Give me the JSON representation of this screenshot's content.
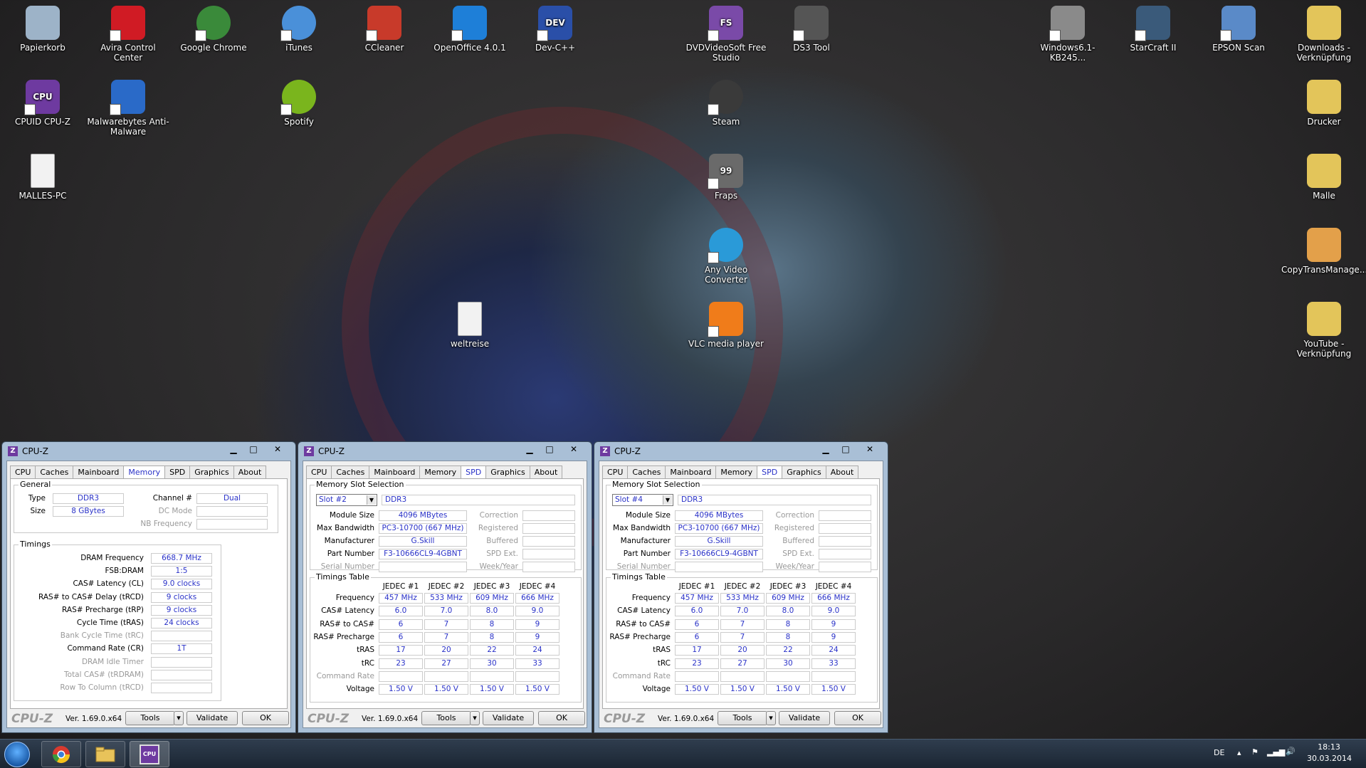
{
  "desktop_icons": [
    {
      "label": "Papierkorb",
      "icon": "recycle-bin-icon",
      "color": "#9db3c8"
    },
    {
      "label": "Avira Control Center",
      "icon": "avira-icon",
      "color": "#d01b24"
    },
    {
      "label": "Google Chrome",
      "icon": "chrome-icon",
      "color": "#3a8a3a"
    },
    {
      "label": "iTunes",
      "icon": "itunes-icon",
      "color": "#4a90d9"
    },
    {
      "label": "CCleaner",
      "icon": "ccleaner-icon",
      "color": "#c83a2a"
    },
    {
      "label": "OpenOffice 4.0.1",
      "icon": "openoffice-icon",
      "color": "#1e7fd8"
    },
    {
      "label": "Dev-C++",
      "icon": "devcpp-icon",
      "color": "#2a4fa8",
      "glyph": "DEV"
    },
    {
      "label": "DVDVideoSoft Free Studio",
      "icon": "dvdvideosoft-icon",
      "color": "#7a4aa8",
      "glyph": "FS"
    },
    {
      "label": "DS3 Tool",
      "icon": "gamepad-icon",
      "color": "#555555"
    },
    {
      "label": "Windows6.1-KB245...",
      "icon": "installer-icon",
      "color": "#8a8a8a"
    },
    {
      "label": "StarCraft II",
      "icon": "starcraft-icon",
      "color": "#3a5a7a"
    },
    {
      "label": "EPSON Scan",
      "icon": "scanner-icon",
      "color": "#5a8ac8"
    },
    {
      "label": "Downloads - Verknüpfung",
      "icon": "folder-icon",
      "color": "#e3c55a"
    },
    {
      "label": "CPUID CPU-Z",
      "icon": "cpuz-icon",
      "color": "#6e3aa0",
      "glyph": "CPU"
    },
    {
      "label": "Malwarebytes Anti-Malware",
      "icon": "malwarebytes-icon",
      "color": "#2a6ac8"
    },
    {
      "label": "Spotify",
      "icon": "spotify-icon",
      "color": "#7ab51d"
    },
    {
      "label": "Steam",
      "icon": "steam-icon",
      "color": "#3a3a3a"
    },
    {
      "label": "Drucker",
      "icon": "folder-icon",
      "color": "#e3c55a"
    },
    {
      "label": "MALLES-PC",
      "icon": "document-icon",
      "color": "#f2f2f2"
    },
    {
      "label": "Fraps",
      "icon": "fraps-icon",
      "color": "#6a6a6a",
      "glyph": "99"
    },
    {
      "label": "Malle",
      "icon": "user-folder-icon",
      "color": "#e3c55a"
    },
    {
      "label": "Any Video Converter",
      "icon": "video-converter-icon",
      "color": "#2a9ad8"
    },
    {
      "label": "CopyTransManage...",
      "icon": "folder-icon",
      "color": "#e3a04a"
    },
    {
      "label": "weltreise",
      "icon": "document-icon",
      "color": "#f2f2f2"
    },
    {
      "label": "VLC media player",
      "icon": "vlc-icon",
      "color": "#f07c1a"
    },
    {
      "label": "YouTube - Verknüpfung",
      "icon": "folder-icon",
      "color": "#e3c55a"
    }
  ],
  "cpuz": {
    "title": "CPU-Z",
    "version": "Ver. 1.69.0.x64",
    "brand": "CPU-Z",
    "tabs": [
      "CPU",
      "Caches",
      "Mainboard",
      "Memory",
      "SPD",
      "Graphics",
      "About"
    ],
    "buttons": {
      "tools": "Tools",
      "validate": "Validate",
      "ok": "OK"
    },
    "memory": {
      "general_title": "General",
      "type_label": "Type",
      "type": "DDR3",
      "size_label": "Size",
      "size": "8 GBytes",
      "channel_label": "Channel #",
      "channel": "Dual",
      "dc_mode_label": "DC Mode",
      "nb_freq_label": "NB Frequency",
      "timings_title": "Timings",
      "timings": [
        {
          "label": "DRAM Frequency",
          "value": "668.7 MHz"
        },
        {
          "label": "FSB:DRAM",
          "value": "1:5"
        },
        {
          "label": "CAS# Latency (CL)",
          "value": "9.0 clocks"
        },
        {
          "label": "RAS# to CAS# Delay (tRCD)",
          "value": "9 clocks"
        },
        {
          "label": "RAS# Precharge (tRP)",
          "value": "9 clocks"
        },
        {
          "label": "Cycle Time (tRAS)",
          "value": "24 clocks"
        },
        {
          "label": "Bank Cycle Time (tRC)",
          "value": ""
        },
        {
          "label": "Command Rate (CR)",
          "value": "1T"
        },
        {
          "label": "DRAM Idle Timer",
          "value": ""
        },
        {
          "label": "Total CAS# (tRDRAM)",
          "value": ""
        },
        {
          "label": "Row To Column (tRCD)",
          "value": ""
        }
      ]
    },
    "spd_labels": {
      "slot_selection": "Memory Slot Selection",
      "module_size": "Module Size",
      "max_bandwidth": "Max Bandwidth",
      "manufacturer": "Manufacturer",
      "part_number": "Part Number",
      "serial_number": "Serial Number",
      "correction": "Correction",
      "registered": "Registered",
      "buffered": "Buffered",
      "spd_ext": "SPD Ext.",
      "week_year": "Week/Year",
      "timings_table": "Timings Table",
      "jedec": [
        "JEDEC #1",
        "JEDEC #2",
        "JEDEC #3",
        "JEDEC #4"
      ],
      "rows": [
        "Frequency",
        "CAS# Latency",
        "RAS# to CAS#",
        "RAS# Precharge",
        "tRAS",
        "tRC",
        "Command Rate",
        "Voltage"
      ]
    },
    "spd_slots": [
      {
        "slot": "Slot #2",
        "type": "DDR3",
        "module_size": "4096 MBytes",
        "max_bandwidth": "PC3-10700 (667 MHz)",
        "manufacturer": "G.Skill",
        "part_number": "F3-10666CL9-4GBNT",
        "table": [
          [
            "457 MHz",
            "533 MHz",
            "609 MHz",
            "666 MHz"
          ],
          [
            "6.0",
            "7.0",
            "8.0",
            "9.0"
          ],
          [
            "6",
            "7",
            "8",
            "9"
          ],
          [
            "6",
            "7",
            "8",
            "9"
          ],
          [
            "17",
            "20",
            "22",
            "24"
          ],
          [
            "23",
            "27",
            "30",
            "33"
          ],
          [
            "",
            "",
            "",
            ""
          ],
          [
            "1.50 V",
            "1.50 V",
            "1.50 V",
            "1.50 V"
          ]
        ]
      },
      {
        "slot": "Slot #4",
        "type": "DDR3",
        "module_size": "4096 MBytes",
        "max_bandwidth": "PC3-10700 (667 MHz)",
        "manufacturer": "G.Skill",
        "part_number": "F3-10666CL9-4GBNT",
        "table": [
          [
            "457 MHz",
            "533 MHz",
            "609 MHz",
            "666 MHz"
          ],
          [
            "6.0",
            "7.0",
            "8.0",
            "9.0"
          ],
          [
            "6",
            "7",
            "8",
            "9"
          ],
          [
            "6",
            "7",
            "8",
            "9"
          ],
          [
            "17",
            "20",
            "22",
            "24"
          ],
          [
            "23",
            "27",
            "30",
            "33"
          ],
          [
            "",
            "",
            "",
            ""
          ],
          [
            "1.50 V",
            "1.50 V",
            "1.50 V",
            "1.50 V"
          ]
        ]
      }
    ]
  },
  "taskbar": {
    "lang": "DE",
    "time": "18:13",
    "date": "30.03.2014"
  }
}
